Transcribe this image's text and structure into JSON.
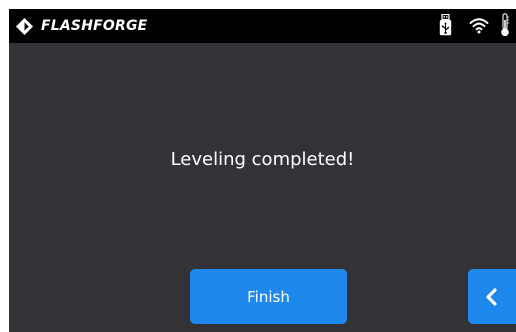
{
  "header": {
    "brand_name": "FLASHFORGE",
    "logo_icon": "flashforge-diamond-logo",
    "status_icons": [
      "usb-icon",
      "wifi-icon",
      "thermometer-icon"
    ]
  },
  "main": {
    "message": "Leveling completed!"
  },
  "footer": {
    "finish_label": "Finish",
    "back_icon": "chevron-left-icon"
  },
  "colors": {
    "screen_background": "#333236",
    "topbar_background": "#000000",
    "accent": "#1e88ec",
    "text": "#ffffff"
  }
}
